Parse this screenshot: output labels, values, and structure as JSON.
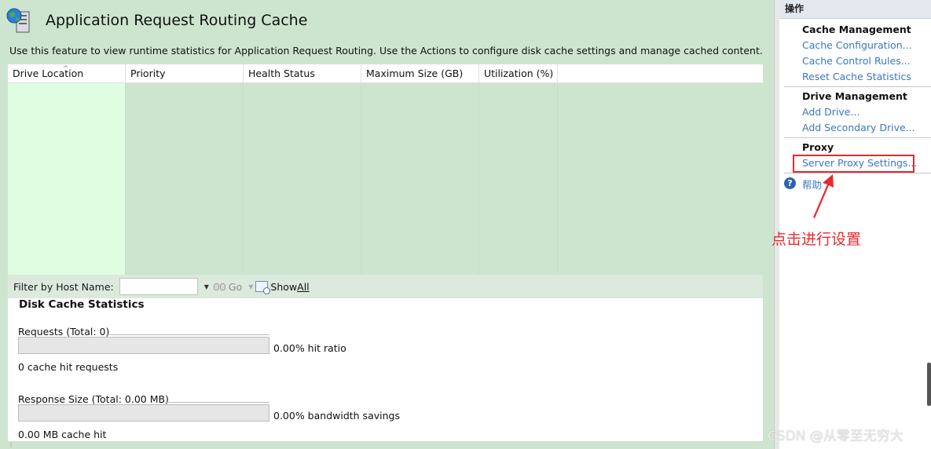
{
  "page": {
    "title": "Application Request Routing Cache",
    "description": "Use this feature to view runtime statistics for Application Request Routing.  Use the Actions to configure disk cache settings and manage cached content."
  },
  "grid": {
    "columns": [
      "Drive Location",
      "Priority",
      "Health Status",
      "Maximum Size (GB)",
      "Utilization (%)"
    ],
    "rows": []
  },
  "filter": {
    "label": "Filter by Host Name:",
    "value": "",
    "go_label": "Go",
    "show_all_prefix": "Show ",
    "show_all_underlined": "All"
  },
  "stats": {
    "title": "Disk Cache Statistics",
    "requests": {
      "label": "Requests (Total: 0)",
      "hit_ratio_fraction": 0,
      "hit_ratio_text": "0.00% hit ratio",
      "cache_hit_text": "0 cache hit requests"
    },
    "response": {
      "label": "Response Size (Total: 0.00 MB)",
      "savings_fraction": 0,
      "savings_text": "0.00% bandwidth savings",
      "cache_hit_text": "0.00 MB cache hit"
    }
  },
  "actions": {
    "header": "操作",
    "groups": [
      {
        "title": "Cache Management",
        "items": [
          "Cache Configuration...",
          "Cache Control Rules...",
          "Reset Cache Statistics"
        ]
      },
      {
        "title": "Drive Management",
        "items": [
          "Add Drive...",
          "Add Secondary Drive..."
        ]
      },
      {
        "title": "Proxy",
        "items": [
          "Server Proxy Settings..."
        ]
      }
    ],
    "help_label": "帮助"
  },
  "annotation": {
    "text": "点击进行设置",
    "color": "#e8292e"
  },
  "watermark": "CSDN @从零至无穷大",
  "colors": {
    "main_bg": "#cde5cf",
    "selected_column": "#e0fde1",
    "link": "#3b77c4",
    "highlight": "#e8292e"
  },
  "icons": {
    "title": "server-globe-icon",
    "go": "binoculars-icon",
    "show_all": "show-all-icon",
    "help": "help-icon"
  }
}
